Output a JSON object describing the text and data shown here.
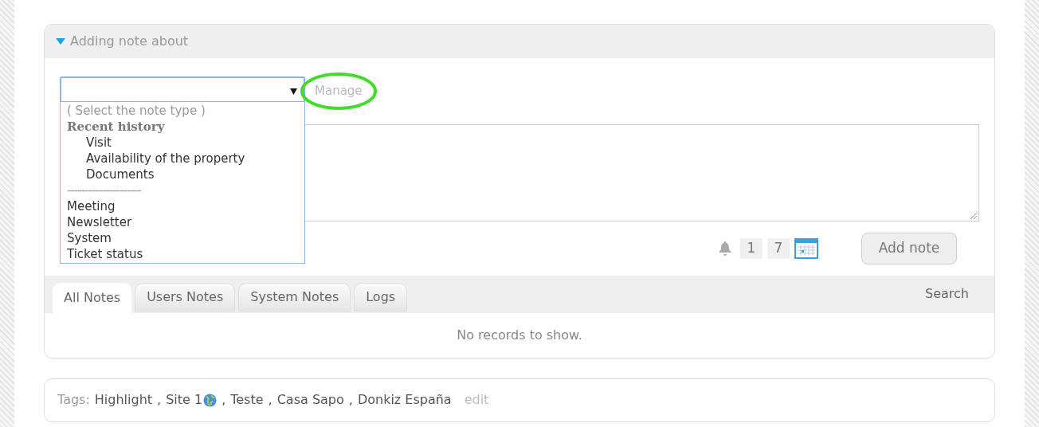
{
  "panel": {
    "title": "Adding note about",
    "expanded": true
  },
  "note_type_select": {
    "open": true,
    "options": [
      {
        "kind": "placeholder",
        "label": "( Select the note type )"
      },
      {
        "kind": "group",
        "label": "Recent history"
      },
      {
        "kind": "child",
        "label": "Visit"
      },
      {
        "kind": "child",
        "label": "Availability of the property"
      },
      {
        "kind": "child",
        "label": "Documents"
      },
      {
        "kind": "separator",
        "label": "---------------------"
      },
      {
        "kind": "option",
        "label": "Meeting"
      },
      {
        "kind": "option",
        "label": "Newsletter"
      },
      {
        "kind": "option",
        "label": "System"
      },
      {
        "kind": "option",
        "label": "Ticket status"
      }
    ]
  },
  "manage_link": "Manage",
  "reminder": {
    "day": "1",
    "count": "7"
  },
  "add_note_button": "Add note",
  "tabs": [
    {
      "label": "All Notes",
      "selected": true
    },
    {
      "label": "Users Notes",
      "selected": false
    },
    {
      "label": "System Notes",
      "selected": false
    },
    {
      "label": "Logs",
      "selected": false
    }
  ],
  "search_link": "Search",
  "empty_message": "No records to show.",
  "tags": {
    "label": "Tags:",
    "items": [
      {
        "label": "Highlight",
        "globe": false
      },
      {
        "label": "Site 1",
        "globe": true
      },
      {
        "label": "Teste",
        "globe": false
      },
      {
        "label": "Casa Sapo",
        "globe": false
      },
      {
        "label": "Donkiz España",
        "globe": false
      }
    ],
    "separator": ",",
    "edit_link": "edit"
  }
}
